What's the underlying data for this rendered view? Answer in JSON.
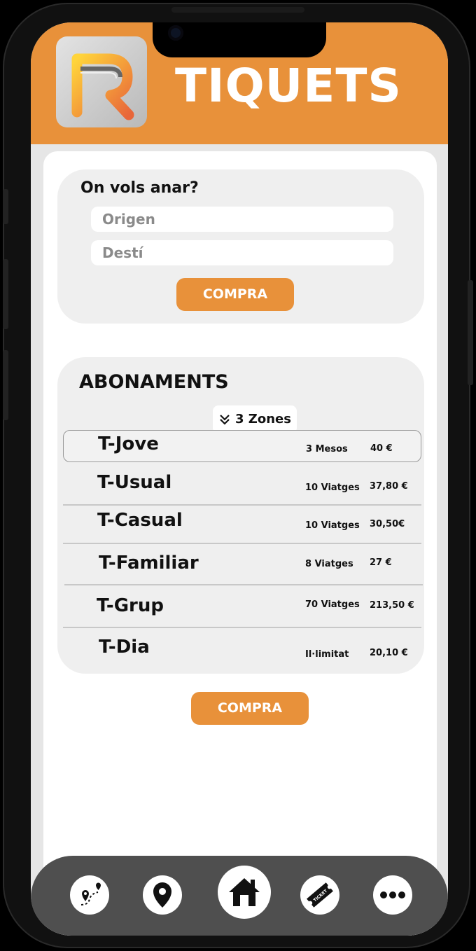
{
  "header": {
    "title": "TIQUETS"
  },
  "search": {
    "question": "On vols anar?",
    "origin_placeholder": "Origen",
    "destination_placeholder": "Destí",
    "buy_label": "COMPRA"
  },
  "subscriptions": {
    "title": "ABONAMENTS",
    "zones_label": "3 Zones",
    "items": [
      {
        "name": "T-Jove",
        "trips": "3 Mesos",
        "price": "40 €"
      },
      {
        "name": "T-Usual",
        "trips": "10 Viatges",
        "price": "37,80 €"
      },
      {
        "name": "T-Casual",
        "trips": "10 Viatges",
        "price": "30,50€"
      },
      {
        "name": "T-Familiar",
        "trips": "8 Viatges",
        "price": "27 €"
      },
      {
        "name": "T-Grup",
        "trips": "70 Viatges",
        "price": "213,50 €"
      },
      {
        "name": "T-Dia",
        "trips": "Il·limitat",
        "price": "20,10 €"
      }
    ],
    "buy_label": "COMPRA"
  },
  "nav": {
    "items": [
      "route-icon",
      "location-pin-icon",
      "home-icon",
      "ticket-icon",
      "more-icon"
    ],
    "ticket_icon_text": "TICKET"
  },
  "colors": {
    "accent": "#e8913a",
    "nav": "#4f4f4f",
    "card": "#efefef"
  }
}
